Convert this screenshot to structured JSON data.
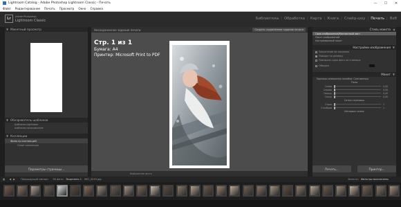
{
  "window": {
    "title": "Lightroom Catalog - Adobe Photoshop Lightroom Classic - Печать",
    "minimize": "—",
    "maximize": "☐",
    "close": "✕"
  },
  "menu": [
    "Файл",
    "Редактирование",
    "Печать",
    "Просмотр",
    "Окно",
    "Справка"
  ],
  "identity": {
    "logo": "Lr",
    "name_small": "Adobe Photoshop",
    "name_large": "Lightroom Classic"
  },
  "modules": [
    "Библиотека",
    "Обработка",
    "Карта",
    "Книга",
    "Слайд-шоу",
    "Печать",
    "Веб"
  ],
  "active_module": "Печать",
  "left": {
    "preview_header": "Макетный просмотр",
    "templates_header": "Обозреватель шаблонов",
    "templates": [
      "Шаблоны Lightroom",
      "Шаблоны пользователя"
    ],
    "collections_header": "Коллекции",
    "collection_selected": "Фильтр коллекций",
    "collection_sub": "Смарт-коллекции",
    "page_setup_button": "Параметры страницы..."
  },
  "center": {
    "unsaved_label": "Несохраненное задание печати",
    "save_button": "Создать сохраненное задание печати",
    "info_page": "Стр. 1 из 1",
    "info_paper": "Бумага:  А4",
    "info_printer": "Принтер:  Microsoft Print to PDF",
    "bottom_label": "Выбранное фото"
  },
  "right": {
    "layout_header": "Стиль макета",
    "layout_items": [
      "Одно изображение/Контактный лист",
      "Пакет изображений",
      "Настраиваемый пакет"
    ],
    "image_settings_header": "Настройки изображения",
    "image_checks": [
      "Заполнение по значению",
      "Поворот по размеру",
      "Повторить одно фото на странице"
    ],
    "stroke_label": "Обводка",
    "layout_sect_header": "Макет",
    "ruler_units": "Единицы измерения линейки:  Сантиметры",
    "margins_title": "Поля",
    "margins": [
      {
        "label": "Слева",
        "value": "0,00"
      },
      {
        "label": "Справа",
        "value": "0,00"
      },
      {
        "label": "Сверху",
        "value": "0,00"
      },
      {
        "label": "Снизу",
        "value": "0,00"
      }
    ],
    "grid_title": "Сетка страницы",
    "grid": [
      {
        "label": "Строк",
        "value": "1"
      },
      {
        "label": "Столбцов",
        "value": "1"
      }
    ],
    "cell_title": "Интервал ячеек",
    "print_button": "Печать...",
    "printer_button": "Принтер..."
  },
  "filmstrip": {
    "source": "Предыдущий импорт",
    "count": "56 фото",
    "selected": "Выделено 1",
    "filename": "IMG_4049.jpg",
    "filter_label": "Фильтр:",
    "filter_value": "Фильтры выключены",
    "selected_index": 4,
    "thumb_colors": [
      "#7b5c4b",
      "#8f7464",
      "#b2a49a",
      "#6f6152",
      "#d8dde0",
      "#5d4a3f",
      "#8b6d5b",
      "#9c8e7e",
      "#6a5b4f",
      "#a59487",
      "#7e6a58",
      "#c9b9a8",
      "#5b4c41",
      "#8e7a67",
      "#b4a18d",
      "#6d5848",
      "#9a8370",
      "#c0aa95",
      "#73604f",
      "#887666",
      "#a79381",
      "#5f4d40",
      "#917d6b",
      "#b8a692",
      "#6b5a4a",
      "#9d8a77",
      "#c3b09c",
      "#776353",
      "#8a7866",
      "#a48f7c"
    ]
  },
  "colors": {
    "panel": "#313131",
    "background": "#4c4c4c",
    "active_text": "#e8e8e8"
  }
}
